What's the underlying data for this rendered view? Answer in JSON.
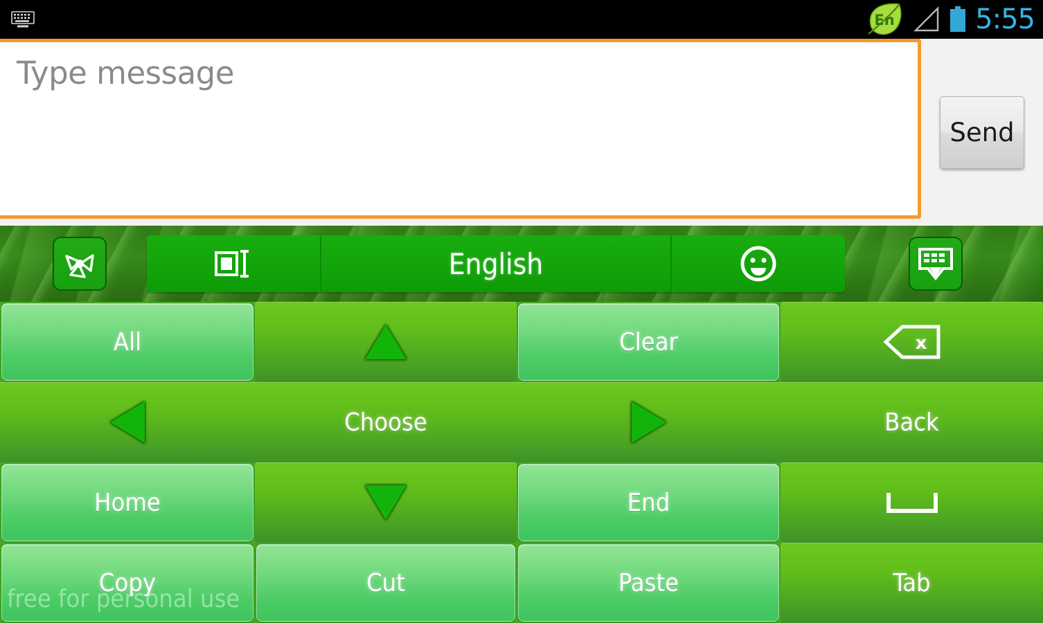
{
  "status_bar": {
    "keyboard_icon": "keyboard-icon",
    "language_indicator": "En",
    "language_icon": "leaf-language-icon",
    "signal_icon": "signal-triangle-icon",
    "battery_icon": "battery-icon",
    "time": "5:55",
    "clock_color": "#33b5e5"
  },
  "compose": {
    "message_placeholder": "Type message",
    "message_value": "",
    "focus_border_color": "#f79a2b",
    "send_label": "Send"
  },
  "keyboard": {
    "toolbar": {
      "theme_icon": "theme-swirl-icon",
      "layout_icon": "text-cursor-layout-icon",
      "language_label": "English",
      "emoji_icon": "emoji-smiley-icon",
      "hide_icon": "hide-keyboard-icon",
      "background_color": "#2f7a16",
      "segment_color": "#13a80c"
    },
    "rows": [
      [
        {
          "name": "key-all",
          "label": "All",
          "style": "light",
          "icon": null
        },
        {
          "name": "key-arrow-up",
          "label": "",
          "style": "dark",
          "icon": "arrow-up-icon"
        },
        {
          "name": "key-clear",
          "label": "Clear",
          "style": "light",
          "icon": null
        },
        {
          "name": "key-backspace",
          "label": "",
          "style": "dark",
          "icon": "backspace-icon"
        }
      ],
      [
        {
          "name": "key-arrow-left",
          "label": "",
          "style": "dark",
          "icon": "arrow-left-icon"
        },
        {
          "name": "key-choose",
          "label": "Choose",
          "style": "dark",
          "icon": null
        },
        {
          "name": "key-arrow-right",
          "label": "",
          "style": "dark",
          "icon": "arrow-right-icon"
        },
        {
          "name": "key-back",
          "label": "Back",
          "style": "dark",
          "icon": null
        }
      ],
      [
        {
          "name": "key-home",
          "label": "Home",
          "style": "light",
          "icon": null
        },
        {
          "name": "key-arrow-down",
          "label": "",
          "style": "dark",
          "icon": "arrow-down-icon"
        },
        {
          "name": "key-end",
          "label": "End",
          "style": "light",
          "icon": null
        },
        {
          "name": "key-space",
          "label": "",
          "style": "dark",
          "icon": "space-bar-icon"
        }
      ],
      [
        {
          "name": "key-copy",
          "label": "Copy",
          "style": "light",
          "icon": null
        },
        {
          "name": "key-cut",
          "label": "Cut",
          "style": "light",
          "icon": null
        },
        {
          "name": "key-paste",
          "label": "Paste",
          "style": "light",
          "icon": null
        },
        {
          "name": "key-tab",
          "label": "Tab",
          "style": "dark",
          "icon": null
        }
      ]
    ]
  },
  "watermark": {
    "text": "free for personal use"
  }
}
